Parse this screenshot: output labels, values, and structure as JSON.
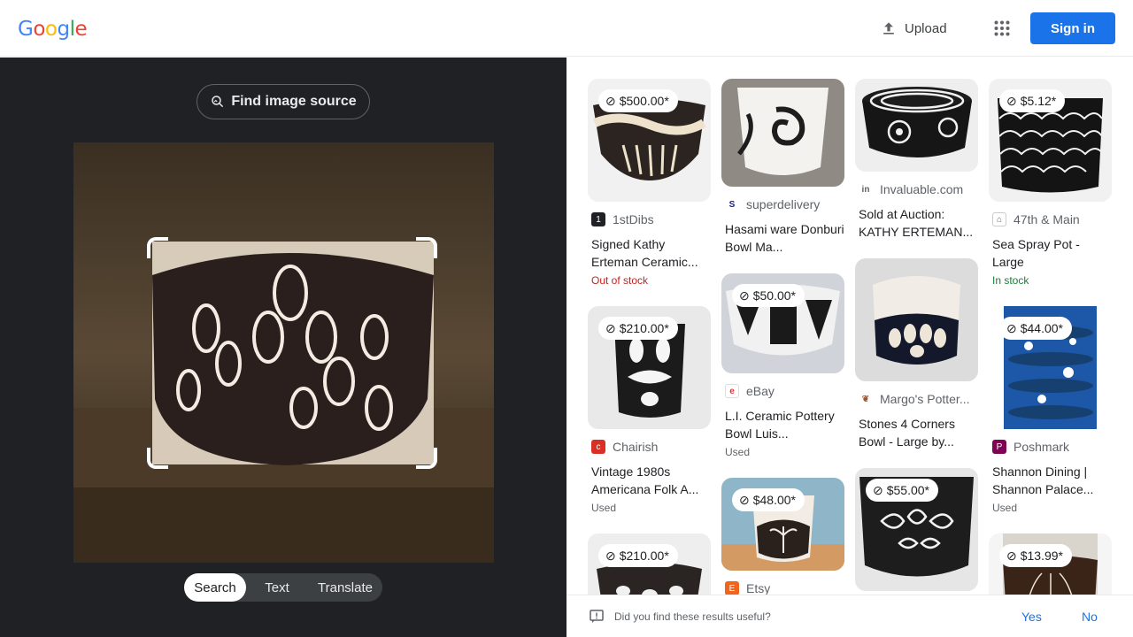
{
  "header": {
    "logo_letters": [
      "G",
      "o",
      "o",
      "g",
      "l",
      "e"
    ],
    "logo_colors": [
      "#4285f4",
      "#ea4335",
      "#fbbc05",
      "#4285f4",
      "#34a853",
      "#ea4335"
    ],
    "upload_label": "Upload",
    "apps_icon": "apps-grid-icon",
    "sign_in_label": "Sign in"
  },
  "left_panel": {
    "find_source_label": "Find image source",
    "modes": [
      "Search",
      "Text",
      "Translate"
    ],
    "active_mode": "Search"
  },
  "results": [
    {
      "price": "$500.00*",
      "source": "1stDibs",
      "title": "Signed Kathy Erteman Ceramic...",
      "status": "Out of stock"
    },
    {
      "price": "",
      "source": "superdelivery",
      "title": "Hasami ware Donburi Bowl Ma...",
      "status": ""
    },
    {
      "price": "",
      "source": "Invaluable.com",
      "title": "Sold at Auction: KATHY ERTEMAN...",
      "status": ""
    },
    {
      "price": "$5.12*",
      "source": "47th & Main",
      "title": "Sea Spray Pot - Large",
      "status": "In stock"
    },
    {
      "price": "$210.00*",
      "source": "Chairish",
      "title": "Vintage 1980s Americana Folk A...",
      "status": "Used"
    },
    {
      "price": "$50.00*",
      "source": "eBay",
      "title": "L.I. Ceramic Pottery Bowl Luis...",
      "status": "Used"
    },
    {
      "price": "",
      "source": "Margo's Potter...",
      "title": "Stones 4 Corners Bowl - Large by...",
      "status": ""
    },
    {
      "price": "$44.00*",
      "source": "Poshmark",
      "title": "Shannon Dining | Shannon Palace...",
      "status": "Used"
    },
    {
      "price": "$210.00*",
      "source": "",
      "title": "",
      "status": ""
    },
    {
      "price": "$48.00*",
      "source": "Etsy",
      "title": "",
      "status": ""
    },
    {
      "price": "$55.00*",
      "source": "",
      "title": "",
      "status": ""
    },
    {
      "price": "$13.99*",
      "source": "",
      "title": "",
      "status": ""
    }
  ],
  "feedback": {
    "question": "Did you find these results useful?",
    "yes_label": "Yes",
    "no_label": "No"
  },
  "colors": {
    "accent": "#1a73e8",
    "dark_panel": "#202124",
    "out_of_stock": "#c5221f",
    "in_stock": "#188038"
  }
}
